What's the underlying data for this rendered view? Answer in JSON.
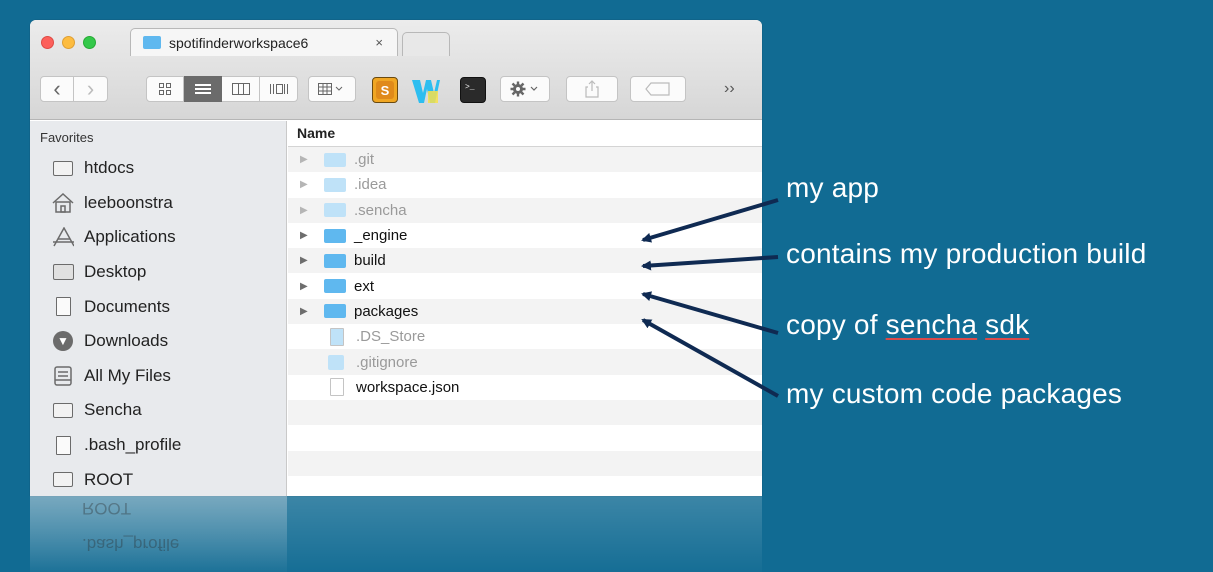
{
  "window": {
    "tab_title": "spotifinderworkspace6",
    "tab_close": "×"
  },
  "toolbar": {
    "back": "‹",
    "forward": "›",
    "more": "››"
  },
  "sidebar": {
    "heading": "Favorites",
    "items": [
      {
        "label": "htdocs",
        "icon": "folder-icon"
      },
      {
        "label": "leeboonstra",
        "icon": "home-icon"
      },
      {
        "label": "Applications",
        "icon": "applications-icon"
      },
      {
        "label": "Desktop",
        "icon": "desktop-icon"
      },
      {
        "label": "Documents",
        "icon": "documents-icon"
      },
      {
        "label": "Downloads",
        "icon": "downloads-icon"
      },
      {
        "label": "All My Files",
        "icon": "all-files-icon"
      },
      {
        "label": "Sencha",
        "icon": "folder-icon"
      },
      {
        "label": ".bash_profile",
        "icon": "file-icon"
      },
      {
        "label": "ROOT",
        "icon": "folder-icon"
      }
    ]
  },
  "filelist": {
    "column": "Name",
    "rows": [
      {
        "name": ".git",
        "type": "folder",
        "hidden": true
      },
      {
        "name": ".idea",
        "type": "folder",
        "hidden": true
      },
      {
        "name": ".sencha",
        "type": "folder",
        "hidden": true
      },
      {
        "name": "_engine",
        "type": "folder",
        "hidden": false
      },
      {
        "name": "build",
        "type": "folder",
        "hidden": false
      },
      {
        "name": "ext",
        "type": "folder",
        "hidden": false
      },
      {
        "name": "packages",
        "type": "folder",
        "hidden": false
      },
      {
        "name": ".DS_Store",
        "type": "file",
        "hidden": true
      },
      {
        "name": ".gitignore",
        "type": "dark-file",
        "hidden": true
      },
      {
        "name": "workspace.json",
        "type": "file",
        "hidden": false
      }
    ]
  },
  "annotations": {
    "a1": "my app",
    "a2": "contains my production build",
    "a3_pre": "copy of ",
    "a3_u1": "sencha",
    "a3_sp": " ",
    "a3_u2": "sdk",
    "a4": "my custom code packages"
  },
  "reflection": {
    "r1": "ROOT",
    "r2": ".bash_profile"
  },
  "colors": {
    "background": "#116b93",
    "folder_blue": "#5fb8ef",
    "arrow": "#0f2a52"
  }
}
